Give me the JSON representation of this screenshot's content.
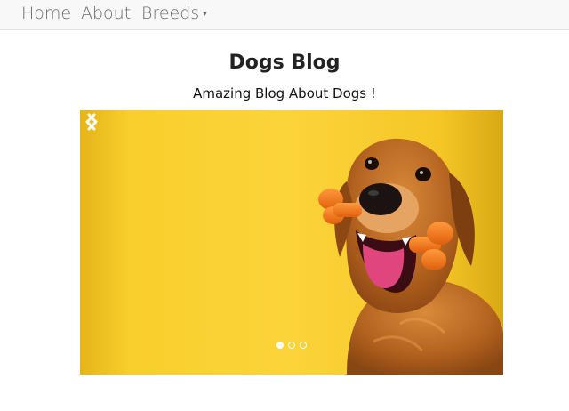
{
  "nav": {
    "items": [
      {
        "label": "Home"
      },
      {
        "label": "About"
      },
      {
        "label": "Breeds"
      }
    ]
  },
  "page": {
    "title": "Dogs Blog",
    "subtitle": "Amazing Blog About Dogs !"
  },
  "carousel": {
    "image": "golden-retriever-with-orange-bone-toy",
    "active_index": 1,
    "slide_count": 3
  },
  "colors": {
    "background_yellow": "#f6c923",
    "dog_fur": "#b5651d",
    "toy_orange": "#f07a1a"
  }
}
